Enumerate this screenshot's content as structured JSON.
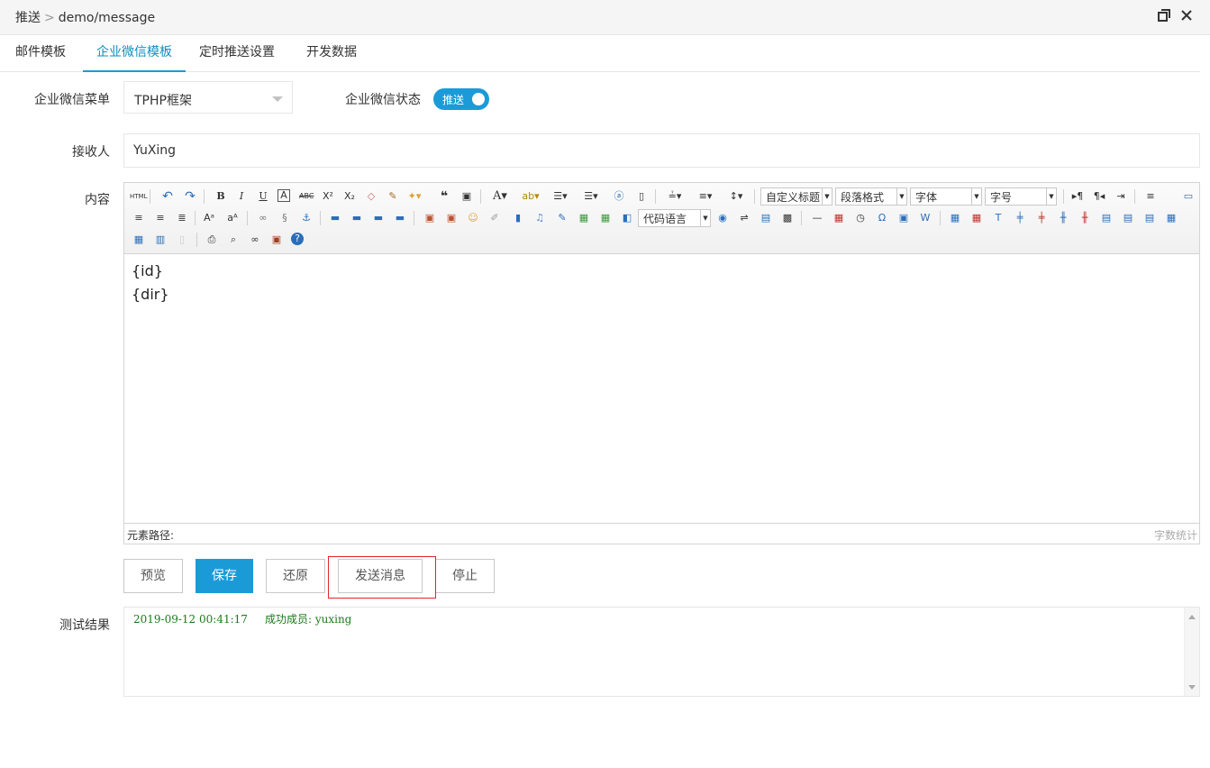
{
  "window": {
    "breadcrumb_root": "推送",
    "breadcrumb_sep": ">",
    "breadcrumb_path": "demo/message"
  },
  "tabs": [
    {
      "label": "邮件模板"
    },
    {
      "label": "企业微信模板"
    },
    {
      "label": "定时推送设置"
    },
    {
      "label": "开发数据"
    }
  ],
  "form": {
    "menu_label": "企业微信菜单",
    "menu_value": "TPHP框架",
    "status_label": "企业微信状态",
    "status_toggle": "推送",
    "receiver_label": "接收人",
    "receiver_value": "YuXing",
    "content_label": "内容",
    "content_lines": [
      "{id}",
      "{dir}"
    ],
    "result_label": "测试结果",
    "result_text": "2019-09-12 00:41:17     成功成员: yuxing"
  },
  "editor": {
    "html_btn": "HTML",
    "custom_title": "自定义标题",
    "paragraph": "段落格式",
    "font": "字体",
    "font_size": "字号",
    "code_lang": "代码语言",
    "element_path": "元素路径:",
    "word_count": "字数统计"
  },
  "buttons": {
    "preview": "预览",
    "save": "保存",
    "restore": "还原",
    "send": "发送消息",
    "stop": "停止"
  },
  "colors": {
    "accent": "#1a9bd7",
    "highlight_border": "#e5232c",
    "result_text": "#1a7a1a"
  }
}
